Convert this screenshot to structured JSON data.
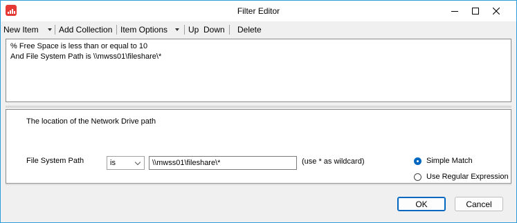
{
  "window": {
    "title": "Filter Editor"
  },
  "toolbar": {
    "new_item": "New Item",
    "add_collection": "Add Collection",
    "item_options": "Item Options",
    "up": "Up",
    "down": "Down",
    "delete": "Delete"
  },
  "filter_text": {
    "line1": "% Free Space is less than or equal to 10",
    "line2": "And File System Path is \\\\mwss01\\fileshare\\*"
  },
  "detail": {
    "description": "The location of the Network Drive path",
    "field_label": "File System Path",
    "operator": "is",
    "value": "\\\\mwss01\\fileshare\\*",
    "hint": "(use * as wildcard)",
    "simple_match": "Simple Match",
    "regex": "Use Regular Expression",
    "match_mode": "simple"
  },
  "buttons": {
    "ok": "OK",
    "cancel": "Cancel"
  },
  "colors": {
    "accent": "#0067c0",
    "window_border": "#2d9cdb",
    "app_icon": "#e53935"
  },
  "icons": {
    "app": "app-bars-icon",
    "minimize": "minimize-icon",
    "maximize": "maximize-icon",
    "close": "close-icon"
  }
}
